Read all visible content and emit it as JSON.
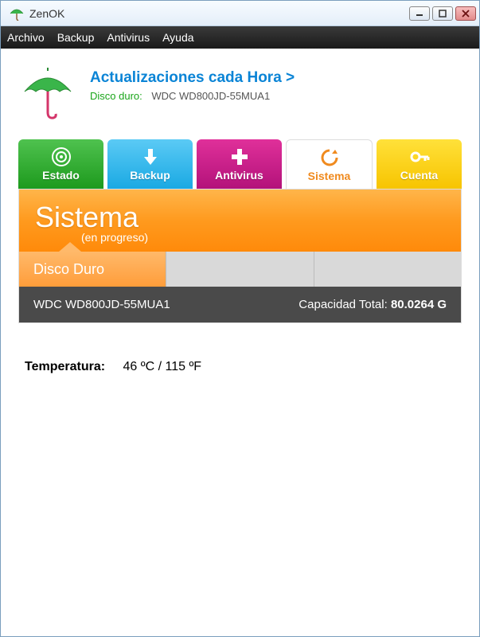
{
  "window": {
    "title": "ZenOK"
  },
  "menu": {
    "items": [
      "Archivo",
      "Backup",
      "Antivirus",
      "Ayuda"
    ]
  },
  "header": {
    "link": "Actualizaciones cada Hora >",
    "disk_label": "Disco duro:",
    "disk_value": "WDC WD800JD-55MUA1"
  },
  "tabs": {
    "estado": "Estado",
    "backup": "Backup",
    "antivirus": "Antivirus",
    "sistema": "Sistema",
    "cuenta": "Cuenta"
  },
  "panel": {
    "title": "Sistema",
    "subtitle": "(en progreso)",
    "subtabs": {
      "disco_duro": "Disco Duro",
      "blank1": "",
      "blank2": ""
    },
    "info": {
      "model": "WDC WD800JD-55MUA1",
      "capacity_label": "Capacidad Total:",
      "capacity_value": "80.0264 G"
    }
  },
  "temperature": {
    "label": "Temperatura:",
    "value": "46 ºC / 115 ºF"
  }
}
